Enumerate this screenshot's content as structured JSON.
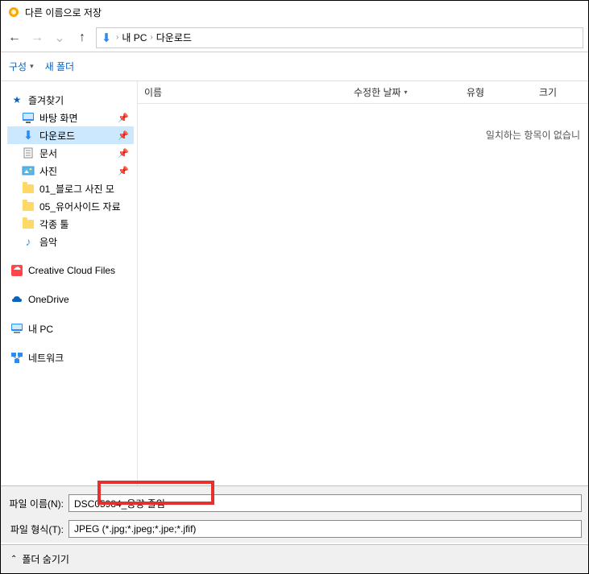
{
  "titlebar": {
    "title": "다른 이름으로 저장"
  },
  "nav": {
    "back": "←",
    "forward": "→",
    "recent_caret": "⌄",
    "up": "↑"
  },
  "breadcrumb": {
    "segments": [
      "내 PC",
      "다운로드"
    ],
    "sep": "›"
  },
  "toolbar": {
    "organize": "구성",
    "new_folder": "새 폴더"
  },
  "sidebar": {
    "quick_access": "즐겨찾기",
    "items": [
      {
        "label": "바탕 화면",
        "pinned": true
      },
      {
        "label": "다운로드",
        "pinned": true,
        "selected": true
      },
      {
        "label": "문서",
        "pinned": true
      },
      {
        "label": "사진",
        "pinned": true
      },
      {
        "label": "01_블로그 사진 모"
      },
      {
        "label": "05_유어사이드 자료"
      },
      {
        "label": "각종 툴"
      },
      {
        "label": "음악"
      }
    ],
    "creative_cloud": "Creative Cloud Files",
    "onedrive": "OneDrive",
    "this_pc": "내 PC",
    "network": "네트워크"
  },
  "columns": {
    "name": "이름",
    "date": "수정한 날짜",
    "type": "유형",
    "size": "크기"
  },
  "empty_message": "일치하는 항목이 없습니",
  "bottom": {
    "filename_label": "파일 이름(N):",
    "filename_value": "DSC05984_용량 줄임",
    "filetype_label": "파일 형식(T):",
    "filetype_value": "JPEG (*.jpg;*.jpeg;*.jpe;*.jfif)"
  },
  "hide_folders": "폴더 숨기기"
}
